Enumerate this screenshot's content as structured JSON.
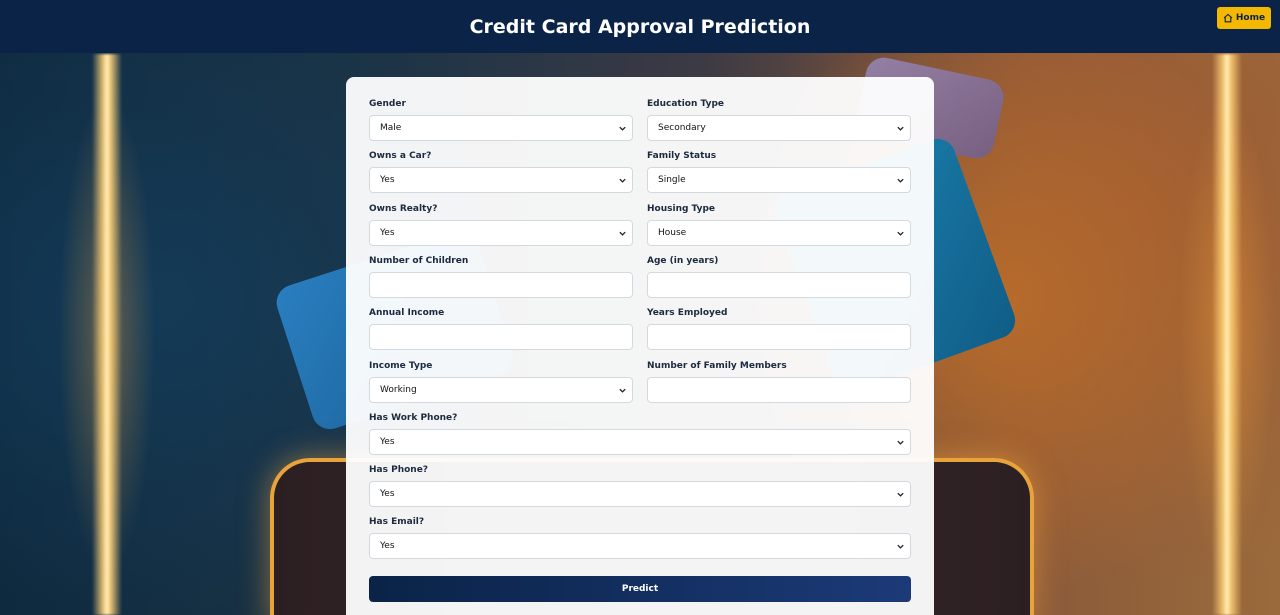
{
  "header": {
    "title": "Credit Card Approval Prediction",
    "home_label": "Home"
  },
  "form": {
    "gender": {
      "label": "Gender",
      "value": "Male"
    },
    "education_type": {
      "label": "Education Type",
      "value": "Secondary"
    },
    "owns_car": {
      "label": "Owns a Car?",
      "value": "Yes"
    },
    "family_status": {
      "label": "Family Status",
      "value": "Single"
    },
    "owns_realty": {
      "label": "Owns Realty?",
      "value": "Yes"
    },
    "housing_type": {
      "label": "Housing Type",
      "value": "House"
    },
    "num_children": {
      "label": "Number of Children",
      "value": ""
    },
    "age": {
      "label": "Age (in years)",
      "value": ""
    },
    "annual_income": {
      "label": "Annual Income",
      "value": ""
    },
    "years_employed": {
      "label": "Years Employed",
      "value": ""
    },
    "income_type": {
      "label": "Income Type",
      "value": "Working"
    },
    "family_members": {
      "label": "Number of Family Members",
      "value": ""
    },
    "work_phone": {
      "label": "Has Work Phone?",
      "value": "Yes"
    },
    "phone": {
      "label": "Has Phone?",
      "value": "Yes"
    },
    "email": {
      "label": "Has Email?",
      "value": "Yes"
    },
    "submit_label": "Predict"
  },
  "colors": {
    "header_bg": "#0a2347",
    "accent": "#f5b800"
  }
}
